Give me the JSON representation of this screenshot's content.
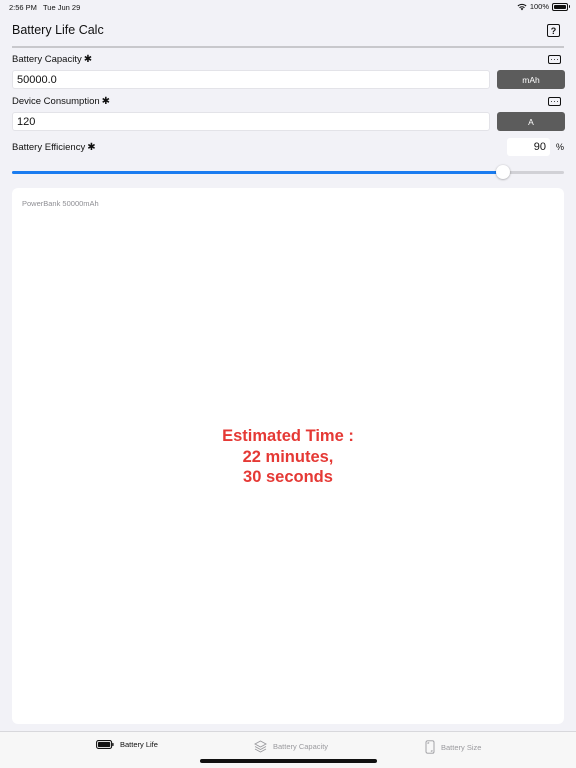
{
  "status_bar": {
    "time": "2:56 PM",
    "date": "Tue Jun 29",
    "battery_percent": "100%"
  },
  "nav": {
    "title": "Battery Life Calc",
    "help_label": "?"
  },
  "battery_capacity": {
    "label": "Battery Capacity",
    "required_mark": "✱",
    "value": "50000.0",
    "unit": "mAh"
  },
  "device_consumption": {
    "label": "Device Consumption",
    "required_mark": "✱",
    "value": "120",
    "unit": "A"
  },
  "battery_efficiency": {
    "label": "Battery Efficiency",
    "required_mark": "✱",
    "value": "90",
    "unit": "%",
    "slider_fraction": 0.89
  },
  "result": {
    "caption": "PowerBank 50000mAh",
    "line1": "Estimated Time :",
    "line2": "22 minutes,",
    "line3": "30 seconds",
    "color": "#e53935"
  },
  "tabs": [
    {
      "label": "Battery Life",
      "icon": "battery-icon",
      "active": true
    },
    {
      "label": "Battery Capacity",
      "icon": "layers-icon",
      "active": false
    },
    {
      "label": "Battery Size",
      "icon": "phone-size-icon",
      "active": false
    }
  ],
  "colors": {
    "accent": "#1a7cf0",
    "unit_button": "#5c5c5c",
    "background": "#f2f2f7"
  }
}
